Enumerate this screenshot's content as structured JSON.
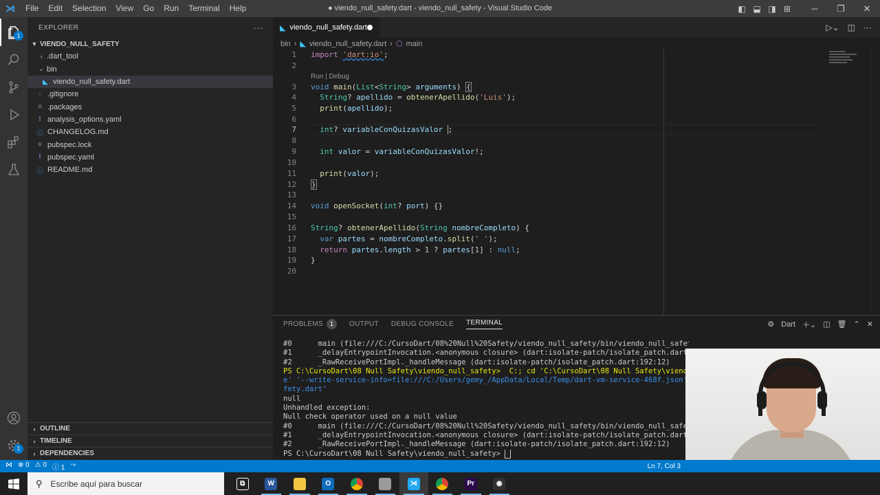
{
  "window": {
    "title": "● viendo_null_safety.dart - viendo_null_safety - Visual Studio Code",
    "menu": [
      "File",
      "Edit",
      "Selection",
      "View",
      "Go",
      "Run",
      "Terminal",
      "Help"
    ]
  },
  "activity_bar": {
    "items": [
      "explorer-icon",
      "search-icon",
      "source-control-icon",
      "run-debug-icon",
      "extensions-icon",
      "testing-icon"
    ],
    "explorer_badge": "1",
    "bottom": [
      "account-icon",
      "settings-icon"
    ]
  },
  "sidebar": {
    "title": "EXPLORER",
    "more": "···",
    "project": "VIENDO_NULL_SAFETY",
    "tree": [
      {
        "label": ".dart_tool",
        "type": "folder-closed"
      },
      {
        "label": "bin",
        "type": "folder-open"
      },
      {
        "label": "viendo_null_safety.dart",
        "type": "dart-file"
      },
      {
        "label": ".gitignore",
        "type": "file"
      },
      {
        "label": ".packages",
        "type": "file"
      },
      {
        "label": "analysis_options.yaml",
        "type": "yaml-file"
      },
      {
        "label": "CHANGELOG.md",
        "type": "info-file"
      },
      {
        "label": "pubspec.lock",
        "type": "file"
      },
      {
        "label": "pubspec.yaml",
        "type": "yaml-file"
      },
      {
        "label": "README.md",
        "type": "info-file"
      }
    ],
    "sections": [
      "OUTLINE",
      "TIMELINE",
      "DEPENDENCIES"
    ]
  },
  "editor": {
    "tab_label": "viendo_null_safety.dart",
    "breadcrumbs": [
      "bin",
      "viendo_null_safety.dart",
      "main"
    ],
    "codelens": "Run | Debug",
    "line_numbers": [
      "1",
      "2",
      "3",
      "4",
      "5",
      "6",
      "7",
      "8",
      "9",
      "10",
      "11",
      "12",
      "13",
      "14",
      "15",
      "16",
      "17",
      "18",
      "19",
      "20"
    ],
    "current_line": "7"
  },
  "panel": {
    "tabs": [
      "PROBLEMS",
      "OUTPUT",
      "DEBUG CONSOLE",
      "TERMINAL"
    ],
    "problems_count": "1",
    "active_tab": "TERMINAL",
    "terminal_profile": "Dart",
    "terminal_lines": [
      "#0      main (file:///C:/CursoDart/08%20Null%20Safety/viendo_null_safety/bin/viendo_null_safety.dart:10:13)",
      "#1      _delayEntrypointInvocation.<anonymous closure> (dart:isolate-patch/isolate_patch.dart:295:",
      "#2      _RawReceivePortImpl._handleMessage (dart:isolate-patch/isolate_patch.dart:192:12)",
      "PS C:\\CursoDart\\08 Null Safety\\viendo_null_safety>  C:; cd 'C:\\CursoDart\\08 Null Safety\\viendo_null",
      "e' '--write-service-info=file:///C:/Users/gemy_/AppData/Local/Temp/dart-vm-service-468f.json' '-DS",
      "fety.dart'",
      "null",
      "Unhandled exception:",
      "Null check operator used on a null value",
      "#0      main (file:///C:/CursoDart/08%20Null%20Safety/viendo_null_safety/bin/viendo_null_safety.da",
      "#1      _delayEntrypointInvocation.<anonymous closure> (dart:isolate-patch/isolate_patch.dart:295:",
      "#2      _RawReceivePortImpl._handleMessage (dart:isolate-patch/isolate_patch.dart:192:12)",
      "PS C:\\CursoDart\\08 Null Safety\\viendo_null_safety> "
    ]
  },
  "statusbar": {
    "errors": "⊗ 0",
    "warnings": "⚠ 0",
    "info": "ⓘ 1",
    "position": "Ln 7, Col 3"
  },
  "taskbar": {
    "search_placeholder": "Escribe aquí para buscar",
    "apps": [
      {
        "name": "task-view",
        "letter": "⧉",
        "color": "#202020"
      },
      {
        "name": "word",
        "letter": "W",
        "color": "#2b579a"
      },
      {
        "name": "file-explorer",
        "letter": "",
        "color": "#f4c542"
      },
      {
        "name": "outlook",
        "letter": "O",
        "color": "#0f6cbd"
      },
      {
        "name": "chrome",
        "letter": "",
        "color": "#db4437"
      },
      {
        "name": "app-window",
        "letter": "",
        "color": "#9a9a9a"
      },
      {
        "name": "vscode",
        "letter": "⋊",
        "color": "#23a9f2"
      },
      {
        "name": "chrome-2",
        "letter": "",
        "color": "#db4437"
      },
      {
        "name": "premiere",
        "letter": "Pr",
        "color": "#2a0a4d"
      },
      {
        "name": "obs",
        "letter": "◉",
        "color": "#303030"
      }
    ]
  }
}
